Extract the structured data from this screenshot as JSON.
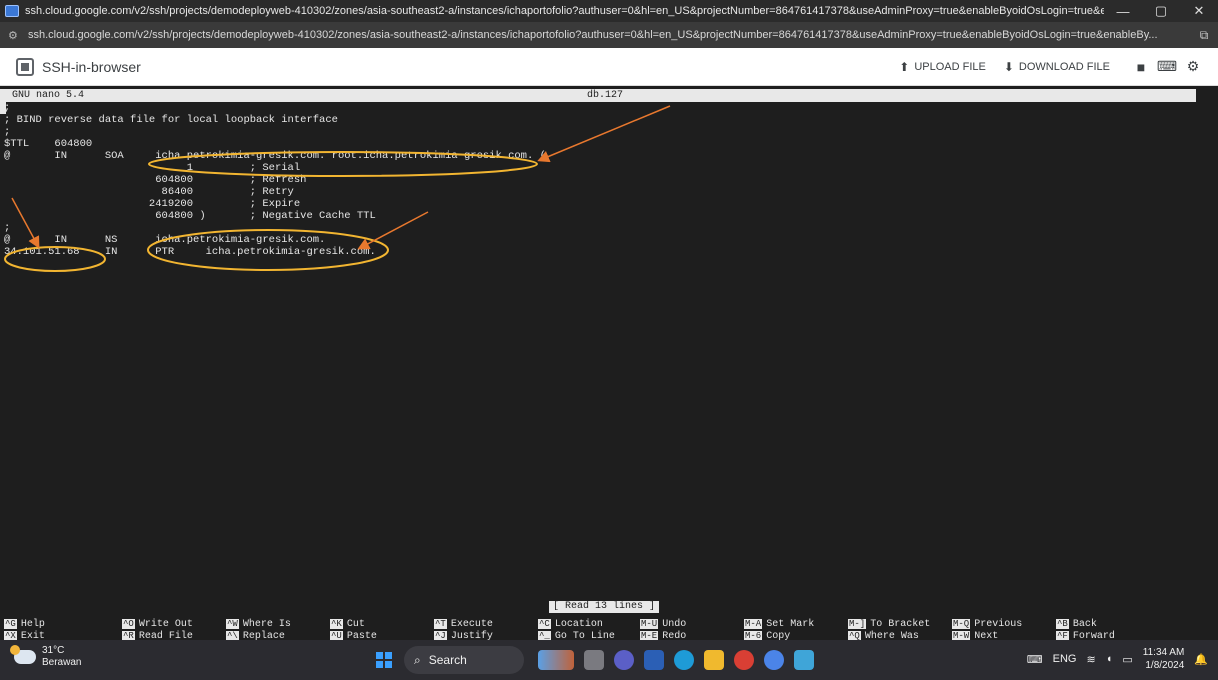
{
  "browser": {
    "window_title": "ssh.cloud.google.com/v2/ssh/projects/demodeployweb-410302/zones/asia-southeast2-a/instances/ichaportofolio?authuser=0&hl=en_US&projectNumber=864761417378&useAdminProxy=true&enableByoidOsLogin=true&enableByoidIap=true - Google Ch...",
    "url": "ssh.cloud.google.com/v2/ssh/projects/demodeployweb-410302/zones/asia-southeast2-a/instances/ichaportofolio?authuser=0&hl=en_US&projectNumber=864761417378&useAdminProxy=true&enableByoidOsLogin=true&enableBy...",
    "minimize": "—",
    "restore": "▢",
    "close": "✕"
  },
  "ssh_toolbar": {
    "title": "SSH-in-browser",
    "upload": "UPLOAD FILE",
    "download": "DOWNLOAD FILE"
  },
  "nano": {
    "version": "GNU nano 5.4",
    "filename": "db.127",
    "lines": [
      ";",
      "; BIND reverse data file for local loopback interface",
      ";",
      "$TTL    604800",
      "@       IN      SOA     icha.petrokimia-gresik.com. root.icha.petrokimia-gresik.com. (",
      "                             1         ; Serial",
      "                        604800         ; Refresh",
      "                         86400         ; Retry",
      "                       2419200         ; Expire",
      "                        604800 )       ; Negative Cache TTL",
      ";",
      "@       IN      NS      icha.petrokimia-gresik.com.",
      "34.101.51.68    IN      PTR     icha.petrokimia-gresik.com."
    ],
    "status": "[ Read 13 lines ]",
    "shortcuts": [
      {
        "key": "^G",
        "label": "Help"
      },
      {
        "key": "^X",
        "label": "Exit"
      },
      {
        "key": "^O",
        "label": "Write Out"
      },
      {
        "key": "^R",
        "label": "Read File"
      },
      {
        "key": "^W",
        "label": "Where Is"
      },
      {
        "key": "^\\",
        "label": "Replace"
      },
      {
        "key": "^K",
        "label": "Cut"
      },
      {
        "key": "^U",
        "label": "Paste"
      },
      {
        "key": "^T",
        "label": "Execute"
      },
      {
        "key": "^J",
        "label": "Justify"
      },
      {
        "key": "^C",
        "label": "Location"
      },
      {
        "key": "^_",
        "label": "Go To Line"
      },
      {
        "key": "M-U",
        "label": "Undo"
      },
      {
        "key": "M-E",
        "label": "Redo"
      },
      {
        "key": "M-A",
        "label": "Set Mark"
      },
      {
        "key": "M-6",
        "label": "Copy"
      },
      {
        "key": "M-]",
        "label": "To Bracket"
      },
      {
        "key": "^Q",
        "label": "Where Was"
      },
      {
        "key": "M-Q",
        "label": "Previous"
      },
      {
        "key": "M-W",
        "label": "Next"
      },
      {
        "key": "^B",
        "label": "Back"
      },
      {
        "key": "^F",
        "label": "Forward"
      }
    ]
  },
  "taskbar": {
    "temperature": "31°C",
    "weather": "Berawan",
    "search_placeholder": "Search",
    "language": "ENG",
    "time": "11:34 AM",
    "date": "1/8/2024"
  },
  "colors": {
    "annotation_ellipse": "#f2b531",
    "annotation_arrow": "#e8782e"
  }
}
